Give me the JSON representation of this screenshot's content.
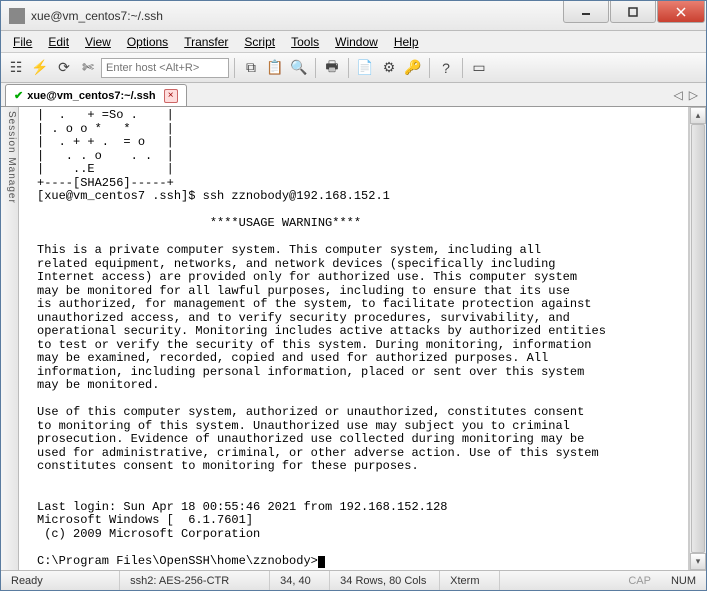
{
  "window": {
    "title": "xue@vm_centos7:~/.ssh"
  },
  "menu": {
    "items": [
      "File",
      "Edit",
      "View",
      "Options",
      "Transfer",
      "Script",
      "Tools",
      "Window",
      "Help"
    ]
  },
  "toolbar": {
    "host_placeholder": "Enter host <Alt+R>"
  },
  "tab": {
    "title": "xue@vm_centos7:~/.ssh"
  },
  "sidebar": {
    "label": "Session Manager"
  },
  "terminal": {
    "lines": [
      "|  .   + =So .    |",
      "| . o o *   *     |",
      "|  . + + .  = o   |",
      "|   . . o    . .  |",
      "|    ..E          |",
      "+----[SHA256]-----+",
      "[xue@vm_centos7 .ssh]$ ssh zznobody@192.168.152.1",
      "",
      "                        ****USAGE WARNING****",
      "",
      "This is a private computer system. This computer system, including all",
      "related equipment, networks, and network devices (specifically including",
      "Internet access) are provided only for authorized use. This computer system",
      "may be monitored for all lawful purposes, including to ensure that its use",
      "is authorized, for management of the system, to facilitate protection against",
      "unauthorized access, and to verify security procedures, survivability, and",
      "operational security. Monitoring includes active attacks by authorized entities",
      "to test or verify the security of this system. During monitoring, information",
      "may be examined, recorded, copied and used for authorized purposes. All",
      "information, including personal information, placed or sent over this system",
      "may be monitored.",
      "",
      "Use of this computer system, authorized or unauthorized, constitutes consent",
      "to monitoring of this system. Unauthorized use may subject you to criminal",
      "prosecution. Evidence of unauthorized use collected during monitoring may be",
      "used for administrative, criminal, or other adverse action. Use of this system",
      "constitutes consent to monitoring for these purposes.",
      "",
      "",
      "Last login: Sun Apr 18 00:55:46 2021 from 192.168.152.128",
      "Microsoft Windows [  6.1.7601]",
      " (c) 2009 Microsoft Corporation",
      "",
      "C:\\Program Files\\OpenSSH\\home\\zznobody>"
    ]
  },
  "status": {
    "ready": "Ready",
    "conn": "ssh2: AES-256-CTR",
    "pos": "34, 40",
    "size": "34 Rows, 80 Cols",
    "term": "Xterm",
    "cap": "CAP",
    "num": "NUM"
  }
}
